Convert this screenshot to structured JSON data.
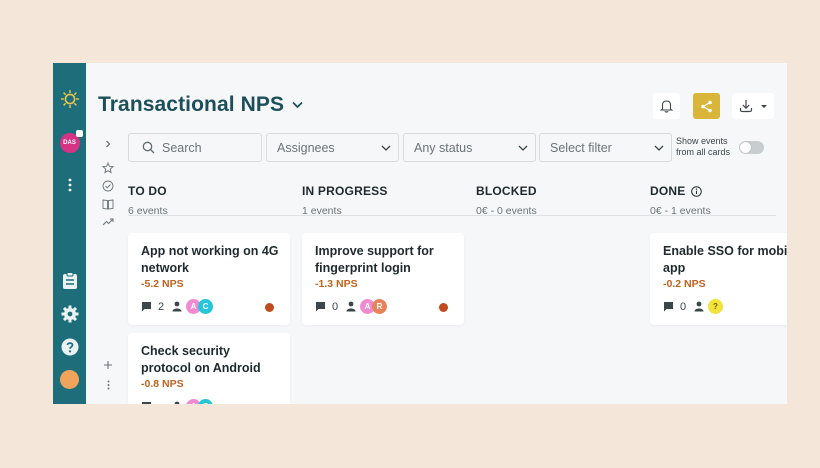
{
  "colors": {
    "rail": "#1e6d7b",
    "title": "#1d4f5a",
    "nps": "#c0621d",
    "share": "#d9b53a",
    "priority": "#c24a1c"
  },
  "rail": {
    "logo_icon": "sun-logo-icon",
    "workspace_badge": "DAS",
    "more_icon": "vertical-dots-icon",
    "bottom_icons": [
      "clipboard-icon",
      "gear-icon",
      "help-icon",
      "user-avatar"
    ]
  },
  "header": {
    "title": "Transactional NPS",
    "title_chevron_icon": "chevron-down-icon",
    "actions": [
      "bell-icon",
      "share-icon",
      "download-icon"
    ]
  },
  "filters": {
    "search_placeholder": "Search",
    "assignees": "Assignees",
    "status": "Any status",
    "select_filter": "Select filter",
    "toggle_label_1": "Show events",
    "toggle_label_2": "from all cards",
    "toggle_on": false
  },
  "side_tools": [
    "chevron-right-icon",
    "star-icon",
    "check-circle-icon",
    "book-icon",
    "trend-icon",
    "plus-icon",
    "vertical-dots-icon"
  ],
  "columns": [
    {
      "name": "TO DO",
      "sub": "6 events"
    },
    {
      "name": "IN PROGRESS",
      "sub": "1 events"
    },
    {
      "name": "BLOCKED",
      "sub": "0€ - 0 events"
    },
    {
      "name": "DONE",
      "sub": "0€ - 1 events"
    }
  ],
  "cards": [
    {
      "title": "App not working on 4G network",
      "nps": "-5.2 NPS",
      "comments": "2",
      "avatars": [
        "A",
        "C"
      ]
    },
    {
      "title": "Check security protocol on Android",
      "nps": "-0.8 NPS",
      "comments": "",
      "avatars": [
        "A",
        "C"
      ]
    },
    {
      "title": "Improve support for fingerprint login",
      "nps": "-1.3 NPS",
      "comments": "0",
      "avatars": [
        "A",
        "R"
      ]
    },
    {
      "title": "Enable SSO for mobile app",
      "nps": "-0.2 NPS",
      "comments": "0",
      "avatars": [
        "?"
      ]
    }
  ]
}
